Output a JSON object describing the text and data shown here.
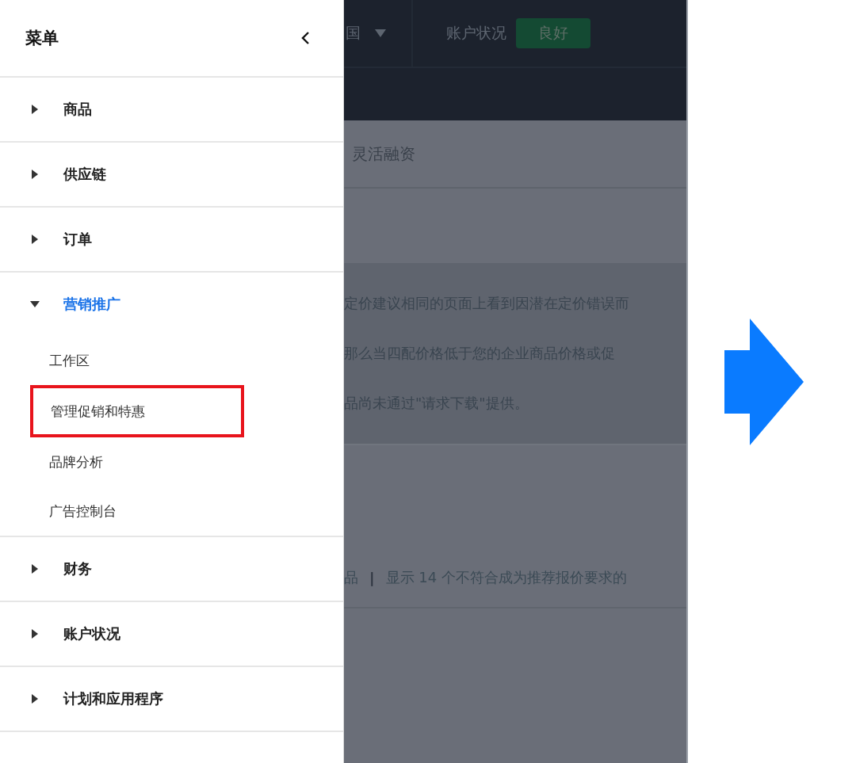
{
  "menu": {
    "title": "菜单",
    "items": [
      {
        "label": "商品",
        "expanded": false
      },
      {
        "label": "供应链",
        "expanded": false
      },
      {
        "label": "订单",
        "expanded": false
      },
      {
        "label": "营销推广",
        "expanded": true,
        "children": [
          {
            "label": "工作区",
            "highlighted": false
          },
          {
            "label": "管理促销和特惠",
            "highlighted": true
          },
          {
            "label": "品牌分析",
            "highlighted": false
          },
          {
            "label": "广告控制台",
            "highlighted": false
          }
        ]
      },
      {
        "label": "财务",
        "expanded": false
      },
      {
        "label": "账户状况",
        "expanded": false
      },
      {
        "label": "计划和应用程序",
        "expanded": false
      }
    ]
  },
  "background_page": {
    "country": "国",
    "account_status_label": "账户状况",
    "account_status": "良好",
    "section_title": "灵活融资",
    "notice_lines": [
      "定价建议相同的页面上看到因潜在定价错误而",
      "那么当四配价格低于您的企业商品价格或促",
      "品尚未通过\"请求下载\"提供。"
    ],
    "filter_left": "品",
    "filter_separator": "|",
    "filter_right": "显示 14 个不符合成为推荐报价要求的"
  }
}
